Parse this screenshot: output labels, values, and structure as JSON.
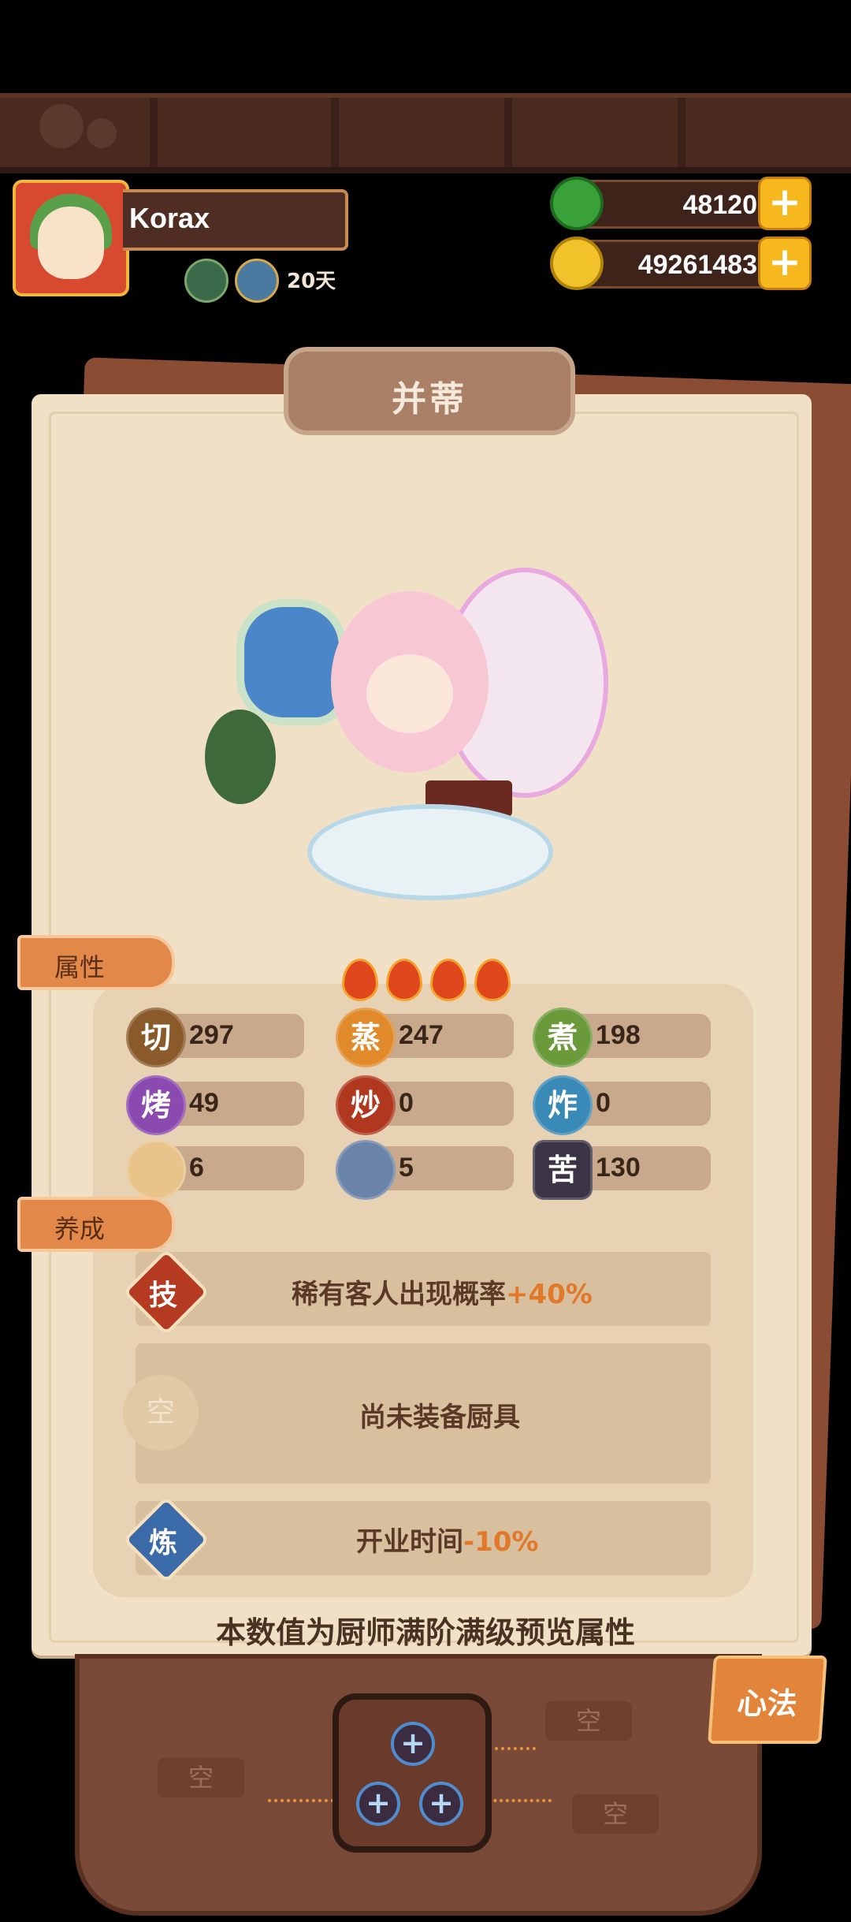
{
  "header": {
    "player_name": "Korax",
    "days_label": "20天",
    "jade": "48120",
    "coins": "49261483",
    "plus_label": "+"
  },
  "card": {
    "title": "并蒂",
    "attributes_tag": "属性",
    "cultivation_tag": "养成",
    "rarity_stars": 4,
    "stats": [
      {
        "icon": "切",
        "value": "297",
        "color": "#8a5a2a"
      },
      {
        "icon": "蒸",
        "value": "247",
        "color": "#e08a2a"
      },
      {
        "icon": "煮",
        "value": "198",
        "color": "#6a9a3a"
      },
      {
        "icon": "烤",
        "value": "49",
        "color": "#8a4ab0"
      },
      {
        "icon": "炒",
        "value": "0",
        "color": "#b0381e"
      },
      {
        "icon": "炸",
        "value": "0",
        "color": "#3a8ab8"
      },
      {
        "icon": "",
        "value": "6",
        "color": "#e8c48a"
      },
      {
        "icon": "",
        "value": "5",
        "color": "#6a84a8"
      },
      {
        "icon": "苦",
        "value": "130",
        "color": "#3a3444"
      }
    ],
    "skill": {
      "badge": "技",
      "text": "稀有客人出现概率",
      "highlight": "+40%"
    },
    "equip": {
      "badge": "空",
      "text": "尚未装备厨具"
    },
    "refine": {
      "badge": "炼",
      "text": "开业时间",
      "highlight": "-10%"
    },
    "note": "本数值为厨师满阶满级预览属性"
  },
  "bottom": {
    "xinfa_label": "心法",
    "empty_slots": [
      "空",
      "空",
      "空"
    ],
    "slot_plus": "+"
  }
}
